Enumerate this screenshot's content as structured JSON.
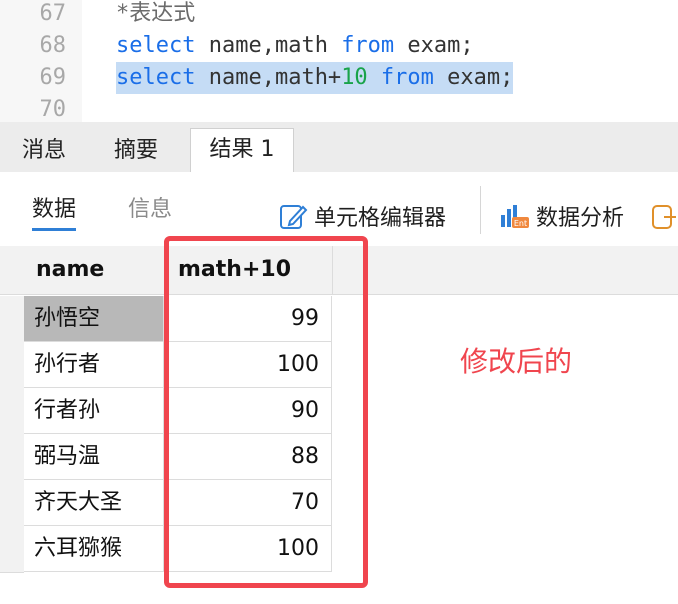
{
  "editor": {
    "lines": [
      {
        "number": "67",
        "text": "*表达式"
      },
      {
        "number": "68",
        "kw1": "select",
        "mid1": " name,math ",
        "kw2": "from",
        "mid2": " exam;"
      },
      {
        "number": "69",
        "kw1": "select",
        "mid1": " name,math+",
        "num": "10",
        "kw2": " from",
        "mid2": " exam;"
      },
      {
        "number": "70"
      }
    ]
  },
  "tabs": [
    "消息",
    "摘要",
    "结果 1"
  ],
  "subtabs": [
    "数据",
    "信息"
  ],
  "toolbar": {
    "cell_editor_label": "单元格编辑器",
    "data_analysis_label": "数据分析"
  },
  "grid": {
    "columns": [
      "name",
      "math+10"
    ],
    "rows": [
      {
        "name": "孙悟空",
        "value": "99"
      },
      {
        "name": "孙行者",
        "value": "100"
      },
      {
        "name": "行者孙",
        "value": "90"
      },
      {
        "name": "弼马温",
        "value": "88"
      },
      {
        "name": "齐天大圣",
        "value": "70"
      },
      {
        "name": "六耳猕猴",
        "value": "100"
      }
    ]
  },
  "annotation": "修改后的",
  "colors": {
    "keyword": "#1a6ee8",
    "number": "#19a34a",
    "selection": "#c5dcf5",
    "annotation": "#f0454e",
    "active_subtab_underline": "#2f7fd6"
  },
  "icons": [
    "pencil-edit-icon",
    "data-analysis-icon",
    "export-icon"
  ]
}
